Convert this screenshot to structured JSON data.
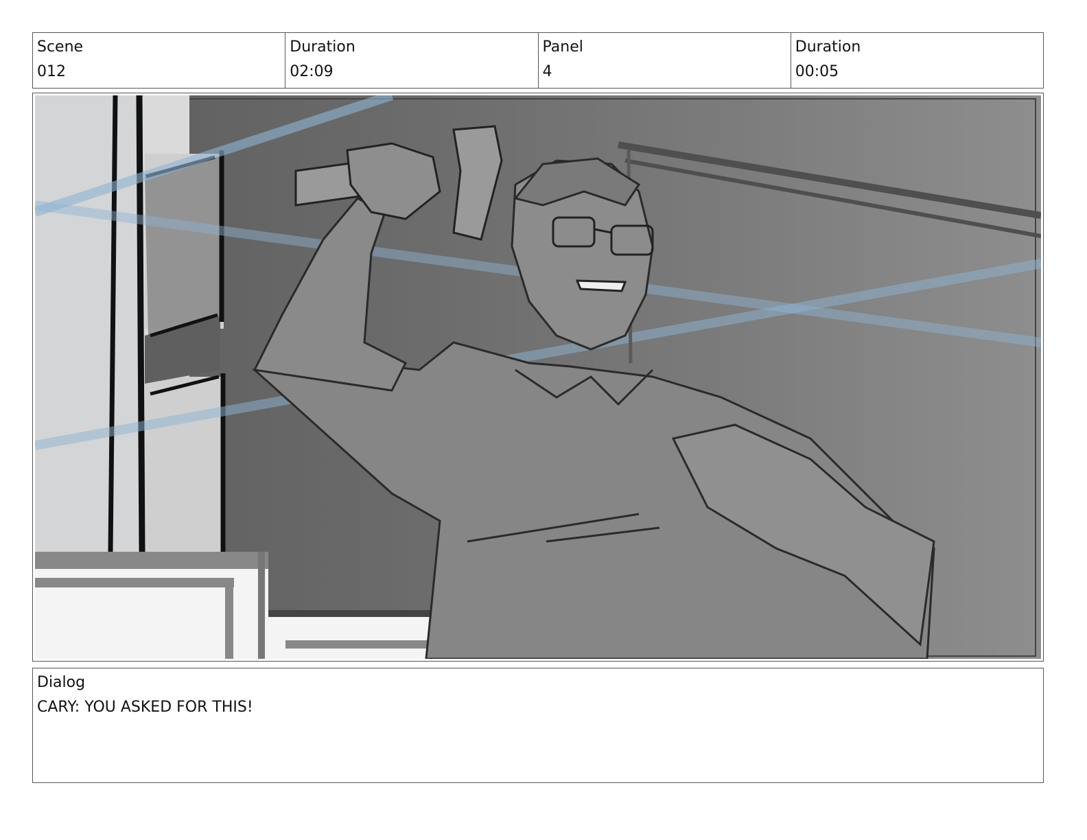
{
  "header": {
    "scene_label": "Scene",
    "scene_value": "012",
    "scene_duration_label": "Duration",
    "scene_duration_value": "02:09",
    "panel_label": "Panel",
    "panel_value": "4",
    "panel_duration_label": "Duration",
    "panel_duration_value": "00:05"
  },
  "dialog": {
    "label": "Dialog",
    "text": "CARY: YOU ASKED FOR THIS!"
  }
}
